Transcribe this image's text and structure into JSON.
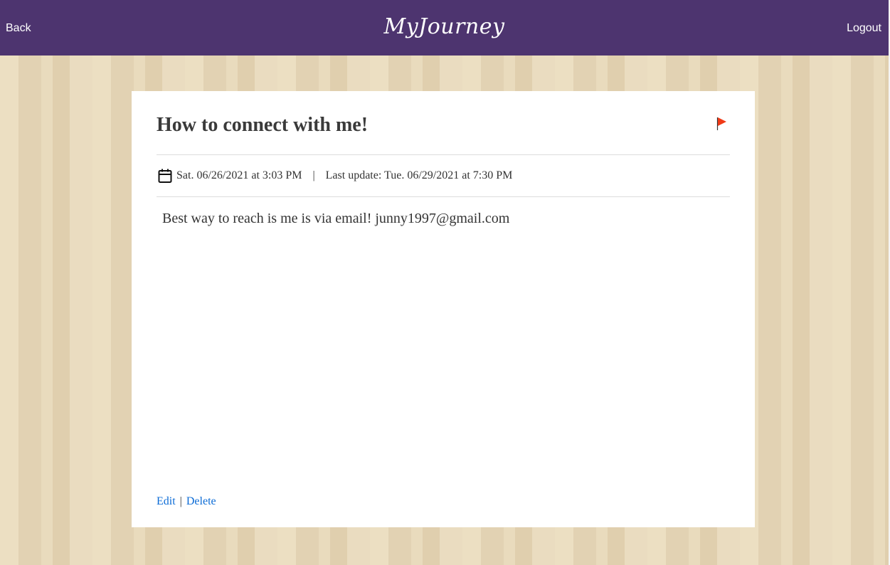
{
  "header": {
    "back_label": "Back",
    "brand_title": "MyJourney",
    "logout_label": "Logout"
  },
  "post": {
    "title": "How to connect with me!",
    "flag_icon": "flag-icon",
    "flag_color": "#f03a17",
    "created": "Sat. 06/26/2021 at 3:03 PM",
    "separator": "|",
    "last_update": "Last update: Tue. 06/29/2021 at 7:30 PM",
    "body": "Best way to reach is me is via email! junny1997@gmail.com"
  },
  "actions": {
    "edit_label": "Edit",
    "separator": "|",
    "delete_label": "Delete"
  },
  "colors": {
    "header_bg": "#4d346f",
    "link": "#0b6bd6",
    "page_bg": "#ead9bb"
  }
}
